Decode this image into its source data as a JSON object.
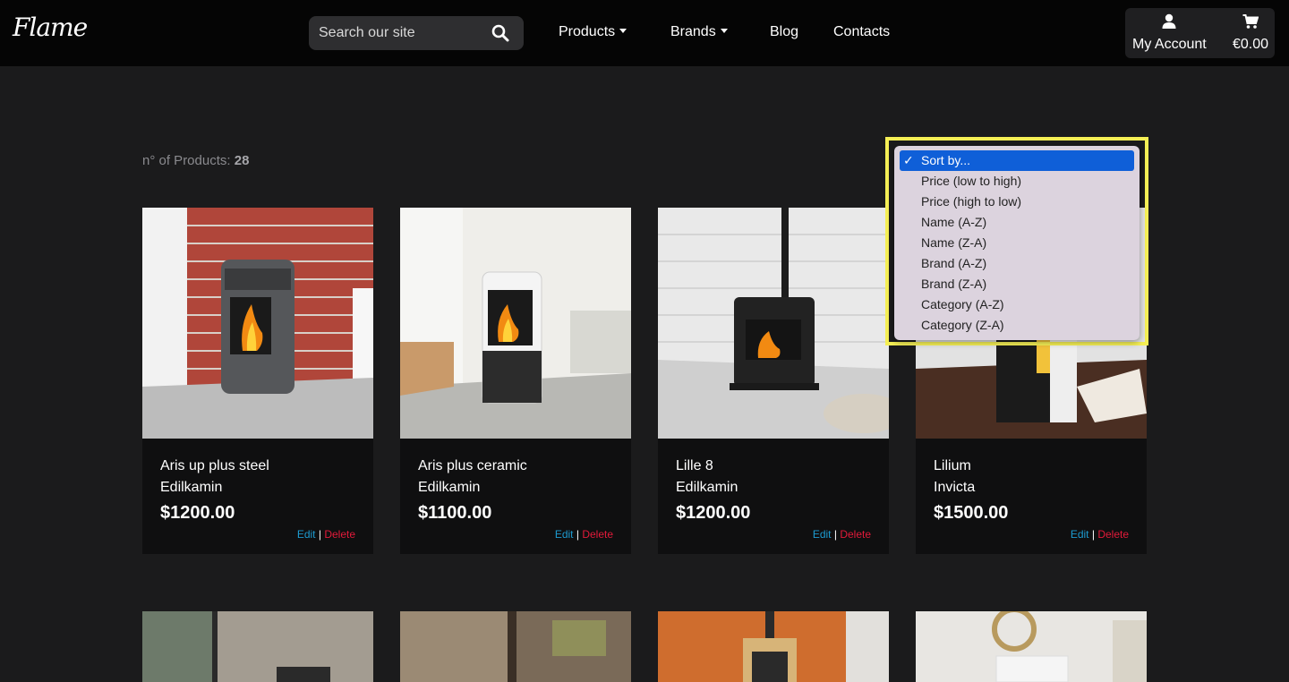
{
  "brand": {
    "logo_text": "Flame"
  },
  "search": {
    "placeholder": "Search our site"
  },
  "nav": {
    "products": "Products",
    "brands": "Brands",
    "blog": "Blog",
    "contacts": "Contacts"
  },
  "account": {
    "label": "My Account",
    "cart_total": "€0.00"
  },
  "listing": {
    "count_label": "n° of Products:",
    "count": "28"
  },
  "sort": {
    "options": [
      "Sort by...",
      "Price (low to high)",
      "Price (high to low)",
      "Name (A-Z)",
      "Name (Z-A)",
      "Brand (A-Z)",
      "Brand (Z-A)",
      "Category (A-Z)",
      "Category (Z-A)"
    ],
    "selected": "Sort by..."
  },
  "products": [
    {
      "name": "Aris up plus steel",
      "brand": "Edilkamin",
      "price": "$1200.00",
      "edit": "Edit",
      "delete": "Delete"
    },
    {
      "name": "Aris plus ceramic",
      "brand": "Edilkamin",
      "price": "$1100.00",
      "edit": "Edit",
      "delete": "Delete"
    },
    {
      "name": "Lille 8",
      "brand": "Edilkamin",
      "price": "$1200.00",
      "edit": "Edit",
      "delete": "Delete"
    },
    {
      "name": "Lilium",
      "brand": "Invicta",
      "price": "$1500.00",
      "edit": "Edit",
      "delete": "Delete"
    }
  ],
  "colors": {
    "accent_link": "#1d9bd1",
    "delete": "#e21a3a",
    "highlight": "#f5ef55",
    "selected_option": "#0f5fd8"
  }
}
